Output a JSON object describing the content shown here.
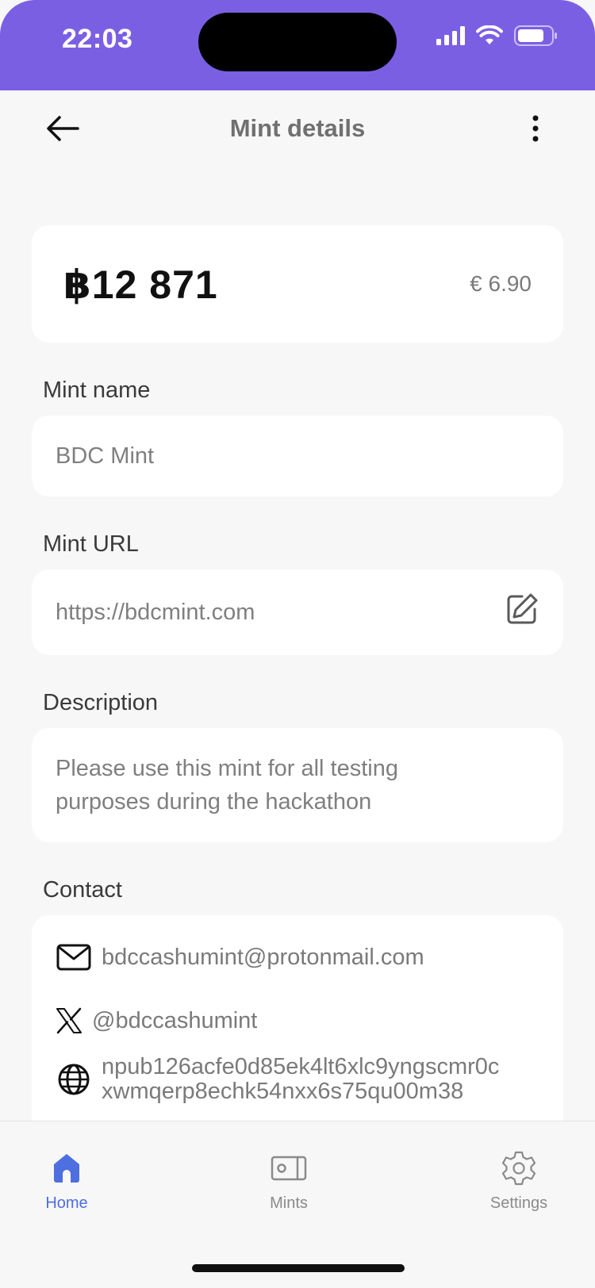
{
  "status_bar": {
    "time": "22:03"
  },
  "header": {
    "title": "Mint details"
  },
  "balance": {
    "amount": "฿12 871",
    "fiat": "€ 6.90"
  },
  "mint_name": {
    "label": "Mint name",
    "value": "BDC Mint"
  },
  "mint_url": {
    "label": "Mint URL",
    "value": "https://bdcmint.com"
  },
  "description": {
    "label": "Description",
    "line1": "Please use this mint for all testing",
    "line2": "purposes during the hackathon"
  },
  "contact": {
    "label": "Contact",
    "email": "bdccashumint@protonmail.com",
    "x_handle": "@bdccashumint",
    "npub_line1": "npub126acfe0d85ek4lt6xlc9yngscmr0c",
    "npub_line2": "xwmqerp8echk54nxx6s75qu00m38"
  },
  "nav": {
    "items": [
      {
        "label": "Home",
        "icon": "home-icon",
        "active": true
      },
      {
        "label": "Mints",
        "icon": "wallet-icon",
        "active": false
      },
      {
        "label": "Settings",
        "icon": "gear-icon",
        "active": false
      }
    ]
  },
  "colors": {
    "accent": "#7b5fe3",
    "active_nav": "#4d6fe0"
  }
}
